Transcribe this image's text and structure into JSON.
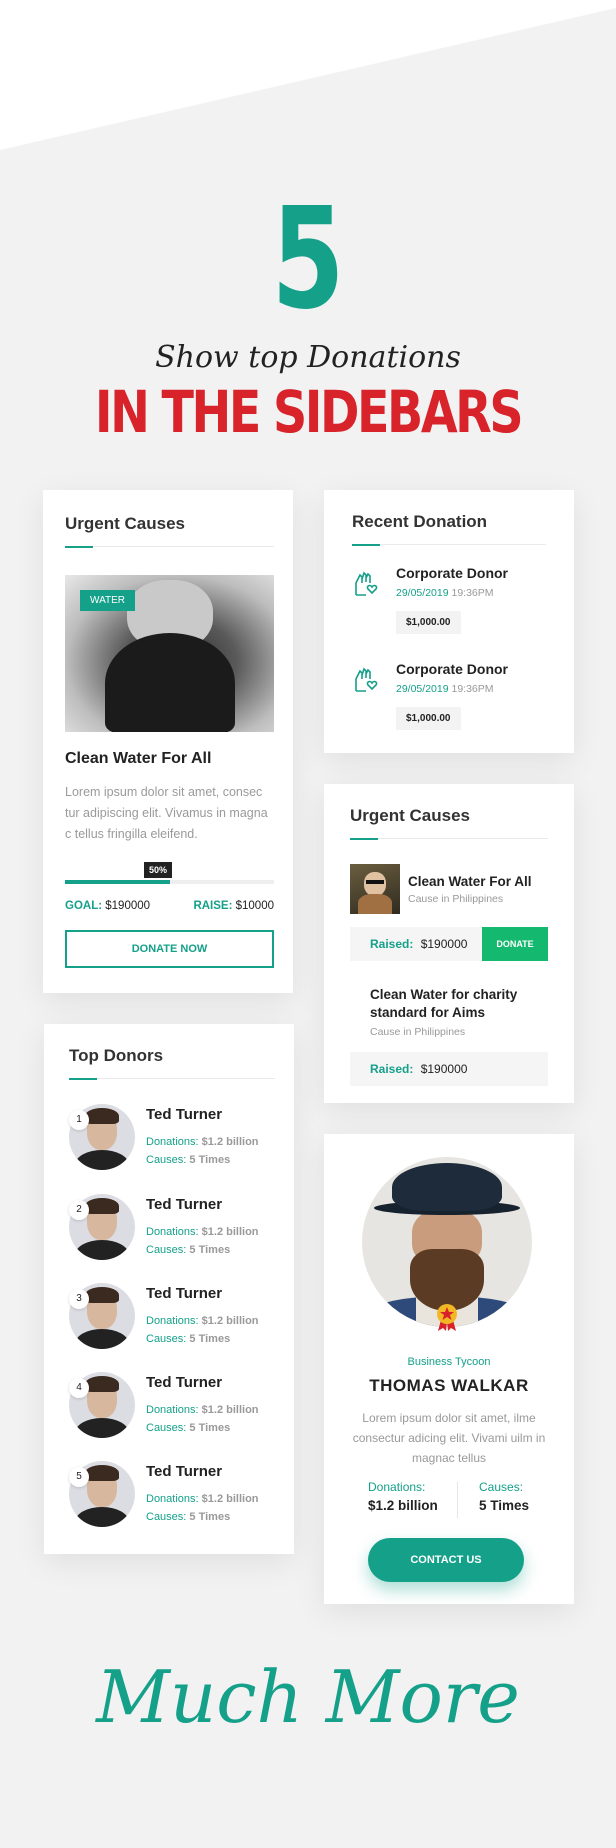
{
  "hero": {
    "number": "5",
    "subtitle": "Show top Donations",
    "title": "IN THE SIDEBARS"
  },
  "urgent_causes_card": {
    "title": "Urgent Causes",
    "tag": "WATER",
    "cause_title": "Clean Water For All",
    "description": "Lorem ipsum dolor sit amet, consec tur adipiscing elit. Vivamus in magna c tellus fringilla eleifend.",
    "progress_label": "50%",
    "progress_value": 0.5,
    "goal_label": "GOAL:",
    "goal_value": "$190000",
    "raise_label": "RAISE:",
    "raise_value": "$10000",
    "button": "DONATE NOW"
  },
  "top_donors_card": {
    "title": "Top Donors",
    "donors": [
      {
        "rank": "1",
        "name": "Ted Turner",
        "donations_label": "Donations:",
        "donations": "$1.2 billion",
        "causes_label": "Causes:",
        "causes": "5 Times"
      },
      {
        "rank": "2",
        "name": "Ted Turner",
        "donations_label": "Donations:",
        "donations": "$1.2 billion",
        "causes_label": "Causes:",
        "causes": "5 Times"
      },
      {
        "rank": "3",
        "name": "Ted Turner",
        "donations_label": "Donations:",
        "donations": "$1.2 billion",
        "causes_label": "Causes:",
        "causes": "5 Times"
      },
      {
        "rank": "4",
        "name": "Ted Turner",
        "donations_label": "Donations:",
        "donations": "$1.2 billion",
        "causes_label": "Causes:",
        "causes": "5 Times"
      },
      {
        "rank": "5",
        "name": "Ted Turner",
        "donations_label": "Donations:",
        "donations": "$1.2 billion",
        "causes_label": "Causes:",
        "causes": "5 Times"
      }
    ]
  },
  "recent_donation_card": {
    "title": "Recent Donation",
    "items": [
      {
        "donor": "Corporate Donor",
        "date": "29/05/2019",
        "time": "19:36PM",
        "amount": "$1,000.00"
      },
      {
        "donor": "Corporate Donor",
        "date": "29/05/2019",
        "time": "19:36PM",
        "amount": "$1,000.00"
      }
    ]
  },
  "urgent_causes_list_card": {
    "title": "Urgent Causes",
    "cause1": {
      "title": "Clean Water For All",
      "location": "Cause in Philippines",
      "raised_label": "Raised:",
      "raised_value": "$190000",
      "button": "DONATE"
    },
    "cause2": {
      "title": "Clean Water for charity standard for Aims",
      "location": "Cause in Philippines",
      "raised_label": "Raised:",
      "raised_value": "$190000"
    }
  },
  "profile_card": {
    "role": "Business Tycoon",
    "name": "THOMAS WALKAR",
    "bio": "Lorem ipsum dolor sit amet, ilme consectur adicing elit. Vivami uilm in magnac tellus",
    "donations_label": "Donations:",
    "donations_value": "$1.2 billion",
    "causes_label": "Causes:",
    "causes_value": "5 Times",
    "button": "CONTACT US"
  },
  "footer": {
    "text": "Much More"
  },
  "colors": {
    "accent": "#15a08a",
    "red": "#d8232a",
    "donate_green": "#15b86f",
    "background": "#f2f2f2"
  }
}
